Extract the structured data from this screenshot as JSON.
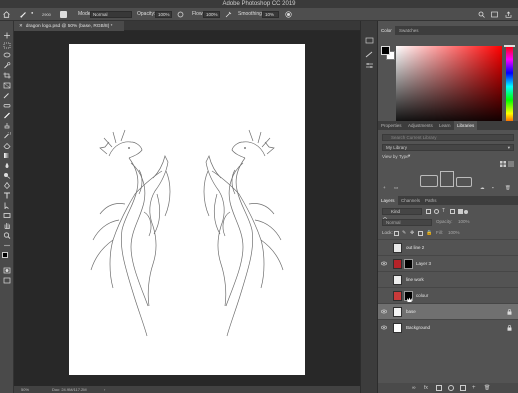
{
  "app": {
    "title": "Adobe Photoshop CC 2019"
  },
  "options_bar": {
    "brush_size": "2900",
    "mode_label": "Mode:",
    "mode_value": "Normal",
    "opacity_label": "Opacity:",
    "opacity_value": "100%",
    "flow_label": "Flow:",
    "flow_value": "100%",
    "smoothing_label": "Smoothing:",
    "smoothing_value": "10%"
  },
  "document": {
    "tab_label": "dragon logo.psd @ 50% (base, RGB/8) *"
  },
  "status_bar": {
    "zoom": "50%",
    "doc_size": "Doc: 24.9M/117.2M"
  },
  "color_panel": {
    "tabs": [
      "Color",
      "Swatches"
    ],
    "active_tab": "Color",
    "foreground": "#000000",
    "background": "#ffffff",
    "hue_color": "#ff0000"
  },
  "libraries_panel": {
    "tabs": [
      "Properties",
      "Adjustments",
      "Learn",
      "Libraries"
    ],
    "active_tab": "Libraries",
    "search_placeholder": "Search Current Library",
    "library_name": "My Library",
    "view_by": "View by Type"
  },
  "layers_panel": {
    "tabs": [
      "Layers",
      "Channels",
      "Paths"
    ],
    "active_tab": "Layers",
    "filter_kind": "Kind",
    "blend_mode": "Normal",
    "opacity_label": "Opacity:",
    "opacity_value": "100%",
    "lock_label": "Lock:",
    "fill_label": "Fill:",
    "fill_value": "100%",
    "layers": [
      {
        "name": "out line 2",
        "visible": false,
        "selected": false,
        "thumb": "#e8e8e8",
        "mask": null,
        "locked": false
      },
      {
        "name": "Layer 3",
        "visible": true,
        "selected": false,
        "thumb": "#b52228",
        "mask": "#000000",
        "locked": false
      },
      {
        "name": "line work",
        "visible": false,
        "selected": false,
        "thumb": "#ededed",
        "mask": null,
        "locked": false
      },
      {
        "name": "colour",
        "visible": false,
        "selected": false,
        "thumb": "#c93a3a",
        "mask": "#000000",
        "locked": false
      },
      {
        "name": "base",
        "visible": true,
        "selected": true,
        "thumb": "#f4f4f4",
        "mask": null,
        "locked": true
      },
      {
        "name": "Background",
        "visible": true,
        "selected": false,
        "thumb": "#ffffff",
        "mask": null,
        "locked": true
      }
    ]
  }
}
